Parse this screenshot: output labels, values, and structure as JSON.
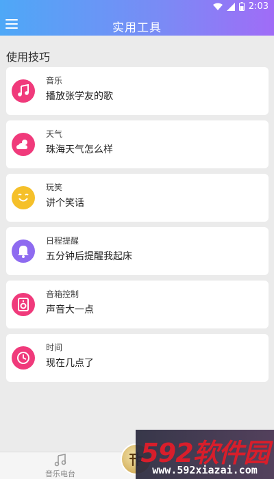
{
  "status_bar": {
    "time": "2:03",
    "icons": [
      "wifi-icon",
      "signal-icon",
      "battery-icon"
    ]
  },
  "app_bar": {
    "title": "实用工具",
    "menu_icon": "hamburger-menu-icon"
  },
  "section": {
    "title": "使用技巧"
  },
  "tips": [
    {
      "category": "音乐",
      "text": "播放张学友的歌",
      "icon": "music-note-icon",
      "color": "#f03a7b"
    },
    {
      "category": "天气",
      "text": "珠海天气怎么样",
      "icon": "weather-icon",
      "color": "#f03a7b"
    },
    {
      "category": "玩笑",
      "text": "讲个笑话",
      "icon": "smile-icon",
      "color": "#f5c02a"
    },
    {
      "category": "日程提醒",
      "text": "五分钟后提醒我起床",
      "icon": "bell-icon",
      "color": "#8e6bf0"
    },
    {
      "category": "音箱控制",
      "text": "声音大一点",
      "icon": "speaker-icon",
      "color": "#f03a7b"
    },
    {
      "category": "时间",
      "text": "现在几点了",
      "icon": "clock-icon",
      "color": "#f03a7b"
    }
  ],
  "bottom_nav": {
    "music_tab": {
      "label": "音乐电台",
      "icon": "music-note-icon"
    },
    "center_icon": "voice-assistant-icon"
  },
  "watermark": {
    "main": "592软件园",
    "sub": "www.592xiazai.com"
  }
}
